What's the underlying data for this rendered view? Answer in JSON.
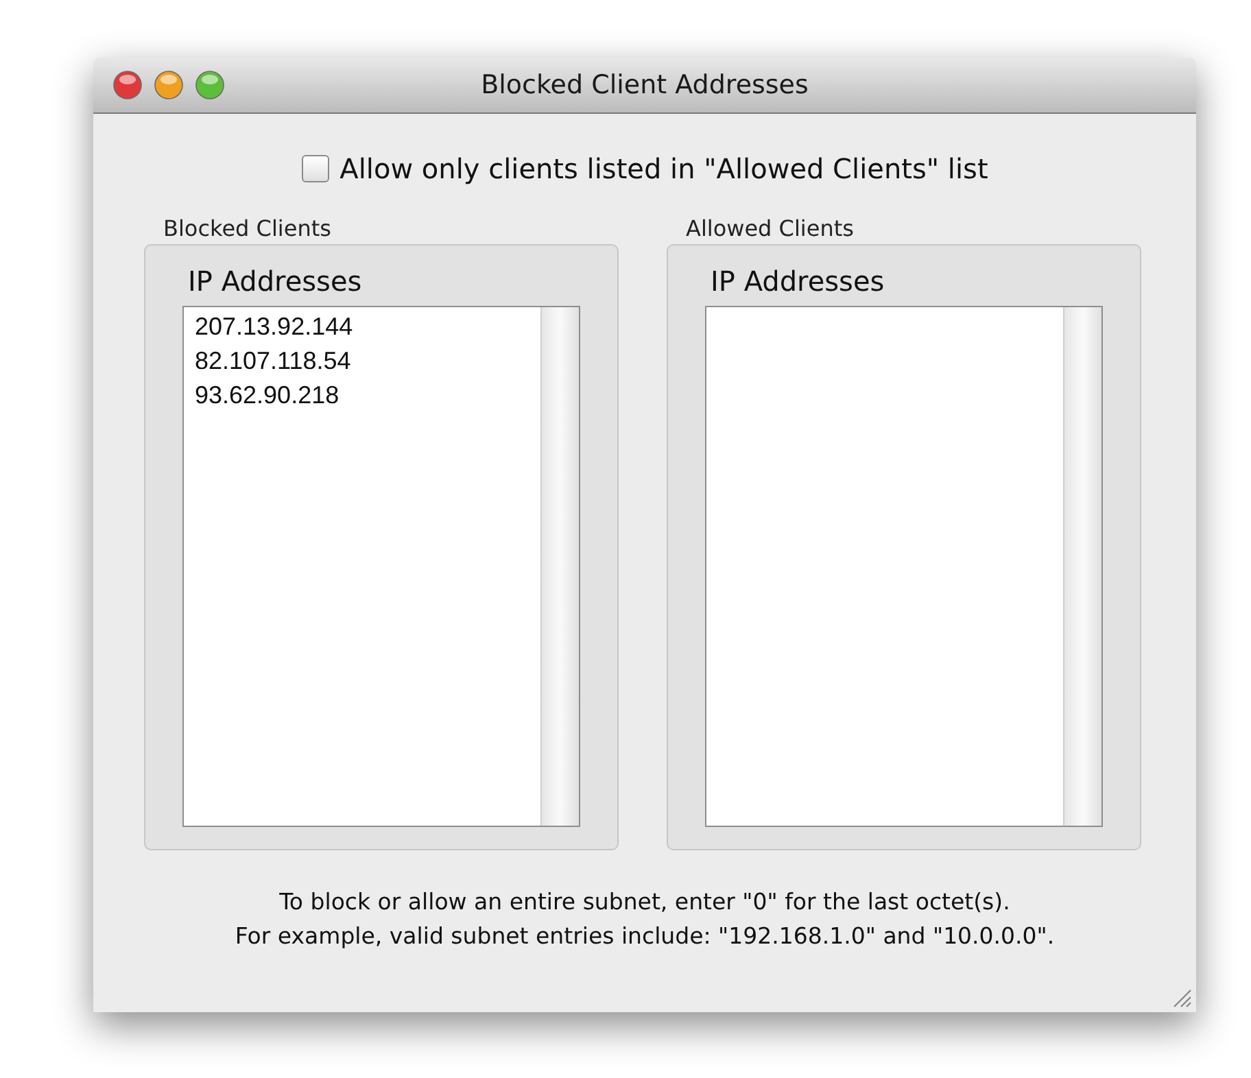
{
  "window": {
    "title": "Blocked Client Addresses"
  },
  "allow_only_checkbox": {
    "label": "Allow only clients listed in \"Allowed Clients\" list",
    "checked": false
  },
  "groups": [
    {
      "label": "Blocked Clients",
      "column": "IP Addresses",
      "rows": [
        "207.13.92.144",
        "82.107.118.54",
        "93.62.90.218"
      ]
    },
    {
      "label": "Allowed Clients",
      "column": "IP Addresses"
    }
  ],
  "notes": [
    "To block or allow an entire subnet, enter \"0\" for the last octet(s).",
    "For example, valid subnet entries include: \"192.168.1.0\" and \"10.0.0.0\"."
  ]
}
